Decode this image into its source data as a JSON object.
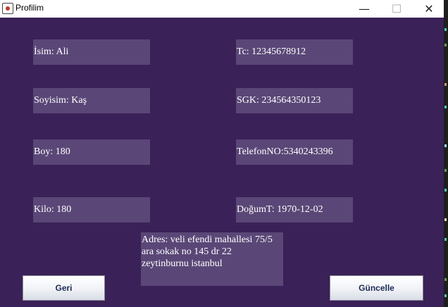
{
  "window": {
    "title": "Profilim",
    "minimize_glyph": "—",
    "maximize_glyph": "☐",
    "close_glyph": "✕"
  },
  "fields": {
    "isim": "İsim: Ali",
    "soyisim": "Soyisim: Kaş",
    "boy": "Boy: 180",
    "kilo": "Kilo: 180",
    "tc": "Tc: 12345678912",
    "sgk": "SGK: 234564350123",
    "telefon": "TelefonNO:5340243396",
    "dogum": "DoğumT: 1970-12-02"
  },
  "address": {
    "line1": "Adres: veli efendi mahallesi 75/5",
    "line2": "ara sokak no 145 dr 22",
    "line3": "zeytinburnu istanbul"
  },
  "buttons": {
    "back": "Geri",
    "update": "Güncelle"
  },
  "colors": {
    "background": "#3a2157",
    "field": "#5a4777",
    "text": "#ffffff"
  }
}
